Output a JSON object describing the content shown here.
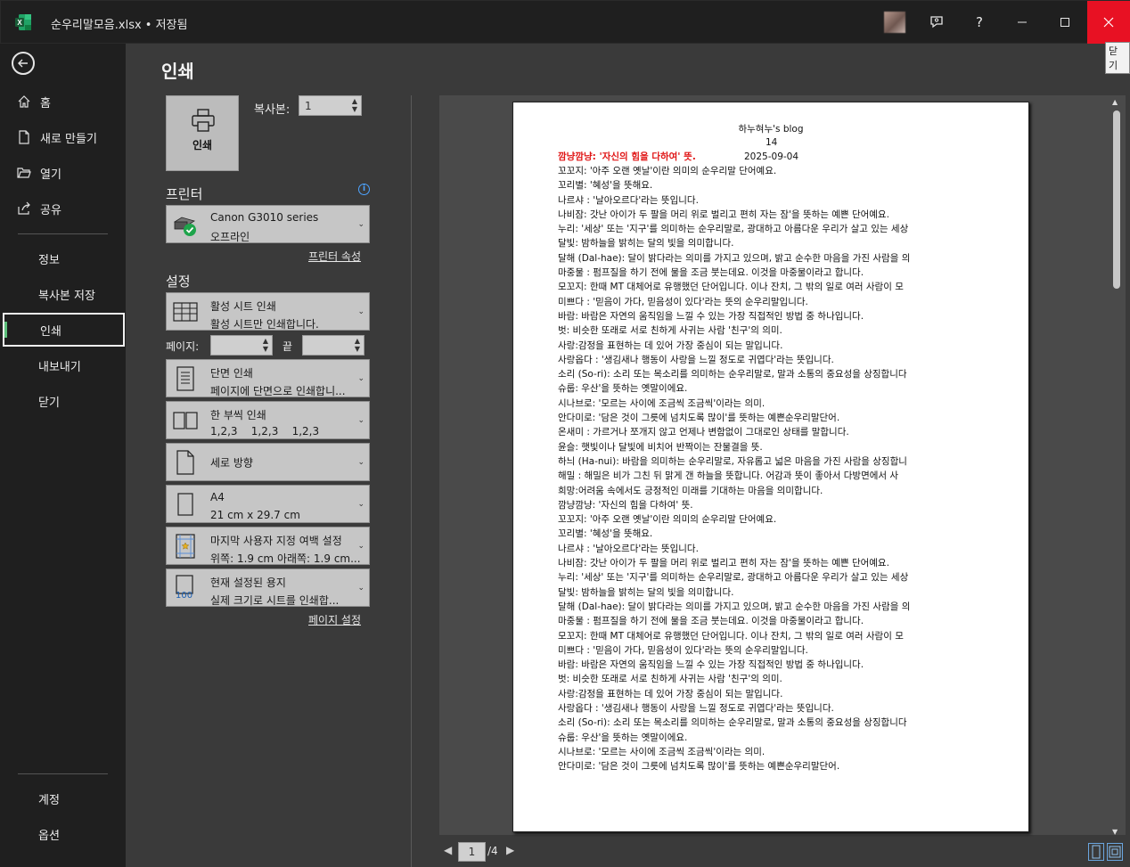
{
  "window": {
    "title": "순우리말모음.xlsx • 저장됨",
    "help": "?",
    "close_tooltip": "닫기"
  },
  "nav": {
    "home": "홈",
    "new": "새로 만들기",
    "open": "열기",
    "share": "공유",
    "info": "정보",
    "save_copy": "복사본 저장",
    "print": "인쇄",
    "export": "내보내기",
    "close": "닫기",
    "account": "계정",
    "options": "옵션"
  },
  "print": {
    "title": "인쇄",
    "print_button": "인쇄",
    "copies_label": "복사본:",
    "copies_value": "1",
    "printer_heading": "프린터",
    "printer_name": "Canon G3010 series",
    "printer_status": "오프라인",
    "printer_properties": "프린터 속성",
    "settings_heading": "설정",
    "scope_title": "활성 시트 인쇄",
    "scope_desc": "활성 시트만 인쇄합니다.",
    "pages_label": "페이지:",
    "pages_to_label": "끝",
    "sides_title": "단면 인쇄",
    "sides_desc": "페이지에 단면으로 인쇄합니...",
    "collate_title": "한 부씩 인쇄",
    "collate_desc": "1,2,3    1,2,3    1,2,3",
    "orientation": "세로 방향",
    "paper_title": "A4",
    "paper_desc": "21 cm x 29.7 cm",
    "margins_title": "마지막 사용자 지정 여백 설정",
    "margins_desc": "위쪽: 1.9 cm 아래쪽: 1.9 cm...",
    "scaling_title": "현재 설정된 용지",
    "scaling_desc": "실제 크기로 시트를 인쇄합...",
    "scaling_badge": "100",
    "page_setup": "페이지 설정"
  },
  "preview": {
    "header_title": "하누혀누's blog",
    "header_page": "14",
    "header_date": "2025-09-04",
    "highlight_line": "깜냥깜냥: '자신의 힘을 다하여' 뜻.",
    "lines": [
      "꼬꼬지: '아주 오랜 옛날'이란 의미의 순우리말 단어예요.",
      "꼬리별: '혜성'을 뜻해요.",
      "나르샤 :  '날아오르다'라는 뜻입니다.",
      "나비잠: 갓난 아이가 두 팔을 머리 위로 벌리고 편히 자는 잠'을 뜻하는 예쁜 단어예요.",
      "누리: '세상' 또는 '지구'를 의미하는 순우리말로, 광대하고 아름다운 우리가 살고 있는 세상",
      "달빛: 밤하늘을 밝히는 달의 빛을 의미합니다.",
      "달해 (Dal-hae): 달이 밝다라는 의미를 가지고 있으며, 밝고 순수한 마음을 가진 사람을 의",
      "마중물 :  펌프질을 하기 전에 물을 조금 붓는데요. 이것을 마중물이라고 합니다.",
      "모꼬지: 한때 MT 대체어로 유행했던 단어입니다. 이나 잔치, 그 밖의 일로 여러 사람이 모",
      "미쁘다 :  '믿음이 가다, 믿음성이 있다'라는 뜻의 순우리말입니다.",
      "바람: 바람은 자연의 움직임을 느낄 수 있는 가장 직접적인 방법 중 하나입니다.",
      "벗: 비슷한 또래로 서로 친하게 사귀는 사람 '친구'의 의미.",
      "사랑:감정을 표현하는 데 있어 가장 중심이 되는 말입니다.",
      "사랑옵다 :  '생김새나 행동이 사랑을 느낄 정도로 귀엽다'라는 뜻입니다.",
      "소리 (So-ri): 소리 또는 목소리를 의미하는 순우리말로, 말과 소통의 중요성을 상징합니다",
      "슈룹: 우산'을 뜻하는 옛말이에요.",
      "시나브로: '모르는 사이에 조금씩 조금씩'이라는 의미.",
      "안다미로: '담은 것이 그릇에 넘치도록 많이'를 뜻하는 예쁜순우리말단어.",
      "온새미 :  가르거나 쪼개지 않고 언제나 변함없이 그대로인 상태를 말합니다.",
      "윤슬: 햇빛이나 달빛에 비치어 반짝이는 잔물결을 뜻.",
      "하늬 (Ha-nui): 바람을 의미하는 순우리말로, 자유롭고 넓은 마음을 가진 사람을 상징합니",
      "해밀 :  해밀은 비가 그친 뒤 맑게 갠 하늘을 뜻합니다. 어감과 뜻이 좋아서 다방면에서 사",
      "희망:어려움 속에서도 긍정적인 미래를 기대하는 마음을 의미합니다.",
      "깜냥깜냥: '자신의 힘을 다하여' 뜻.",
      "꼬꼬지: '아주 오랜 옛날'이란 의미의 순우리말 단어예요.",
      "꼬리별: '혜성'을 뜻해요.",
      "나르샤 :  '날아오르다'라는 뜻입니다.",
      "나비잠: 갓난 아이가 두 팔을 머리 위로 벌리고 편히 자는 잠'을 뜻하는 예쁜 단어예요.",
      "누리: '세상' 또는 '지구'를 의미하는 순우리말로, 광대하고 아름다운 우리가 살고 있는 세상",
      "달빛: 밤하늘을 밝히는 달의 빛을 의미합니다.",
      "달해 (Dal-hae): 달이 밝다라는 의미를 가지고 있으며, 밝고 순수한 마음을 가진 사람을 의",
      "마중물 :  펌프질을 하기 전에 물을 조금 붓는데요. 이것을 마중물이라고 합니다.",
      "모꼬지: 한때 MT 대체어로 유행했던 단어입니다. 이나 잔치, 그 밖의 일로 여러 사람이 모",
      "미쁘다 :  '믿음이 가다, 믿음성이 있다'라는 뜻의 순우리말입니다.",
      "바람: 바람은 자연의 움직임을 느낄 수 있는 가장 직접적인 방법 중 하나입니다.",
      "벗: 비슷한 또래로 서로 친하게 사귀는 사람 '친구'의 의미.",
      "사랑:감정을 표현하는 데 있어 가장 중심이 되는 말입니다.",
      "사랑옵다 :  '생김새나 행동이 사랑을 느낄 정도로 귀엽다'라는 뜻입니다.",
      "소리 (So-ri): 소리 또는 목소리를 의미하는 순우리말로, 말과 소통의 중요성을 상징합니다",
      "슈룹: 우산'을 뜻하는 옛말이에요.",
      "시나브로: '모르는 사이에 조금씩 조금씩'이라는 의미.",
      "안다미로: '담은 것이 그릇에 넘치도록 많이'를 뜻하는 예쁜순우리말단어."
    ],
    "current_page": "1",
    "total_pages": "/4"
  },
  "colors": {
    "accent_green": "#5bbf7a",
    "close_red": "#e81123",
    "highlight_red": "#e01515"
  }
}
